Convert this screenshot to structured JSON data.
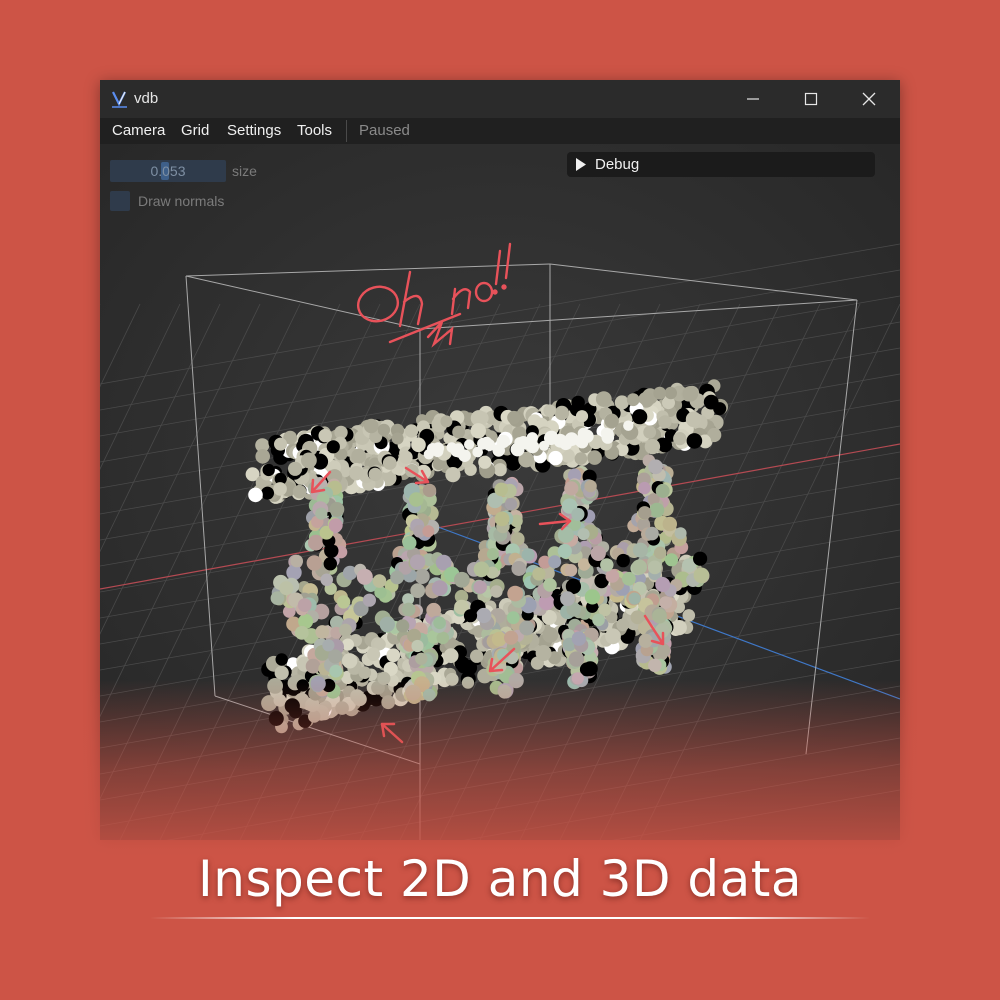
{
  "window": {
    "title": "vdb",
    "app_icon": "vdb-logo-icon",
    "controls": [
      "minimize-icon",
      "maximize-icon",
      "close-icon"
    ]
  },
  "menubar": {
    "items": [
      {
        "label": "Camera"
      },
      {
        "label": "Grid"
      },
      {
        "label": "Settings"
      },
      {
        "label": "Tools"
      }
    ],
    "status": "Paused"
  },
  "controls": {
    "size_slider": {
      "value": "0.053",
      "label": "size",
      "fraction": 0.47
    },
    "draw_normals": {
      "label": "Draw normals",
      "checked": false
    }
  },
  "debug_panel": {
    "label": "Debug",
    "expanded": false
  },
  "annotation": {
    "text": "Oh no!!",
    "color": "#e8525a"
  },
  "colors": {
    "background": "#cd5446",
    "viewport": "#2e2e2e",
    "point_light": "#c6c5b0",
    "point_dark": "#000000",
    "axis_x": "#b44a52",
    "axis_z": "#3f78c8"
  },
  "caption": "Inspect 2D and 3D data"
}
